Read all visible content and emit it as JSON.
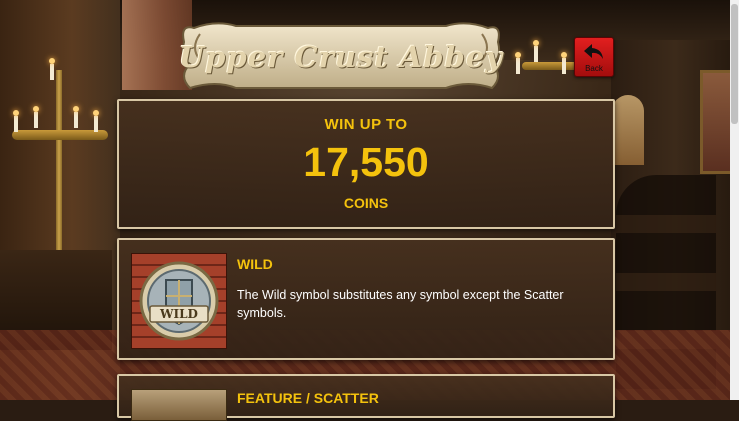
{
  "title": {
    "text": "Upper Crust Abbey"
  },
  "back_button": {
    "label": "Back",
    "icon": "back-arrow-icon",
    "color": "#d81a1a"
  },
  "win_panel": {
    "heading": "WIN UP TO",
    "amount": "17,550",
    "unit": "COINS",
    "accent_color": "#f4c20d"
  },
  "symbols": [
    {
      "title": "WILD",
      "icon": "wild-shield-icon",
      "icon_text": "WILD",
      "description": "The Wild symbol substitutes any symbol except the Scatter symbols."
    },
    {
      "title": "FEATURE / SCATTER",
      "icon": "scatter-symbol-icon"
    }
  ]
}
